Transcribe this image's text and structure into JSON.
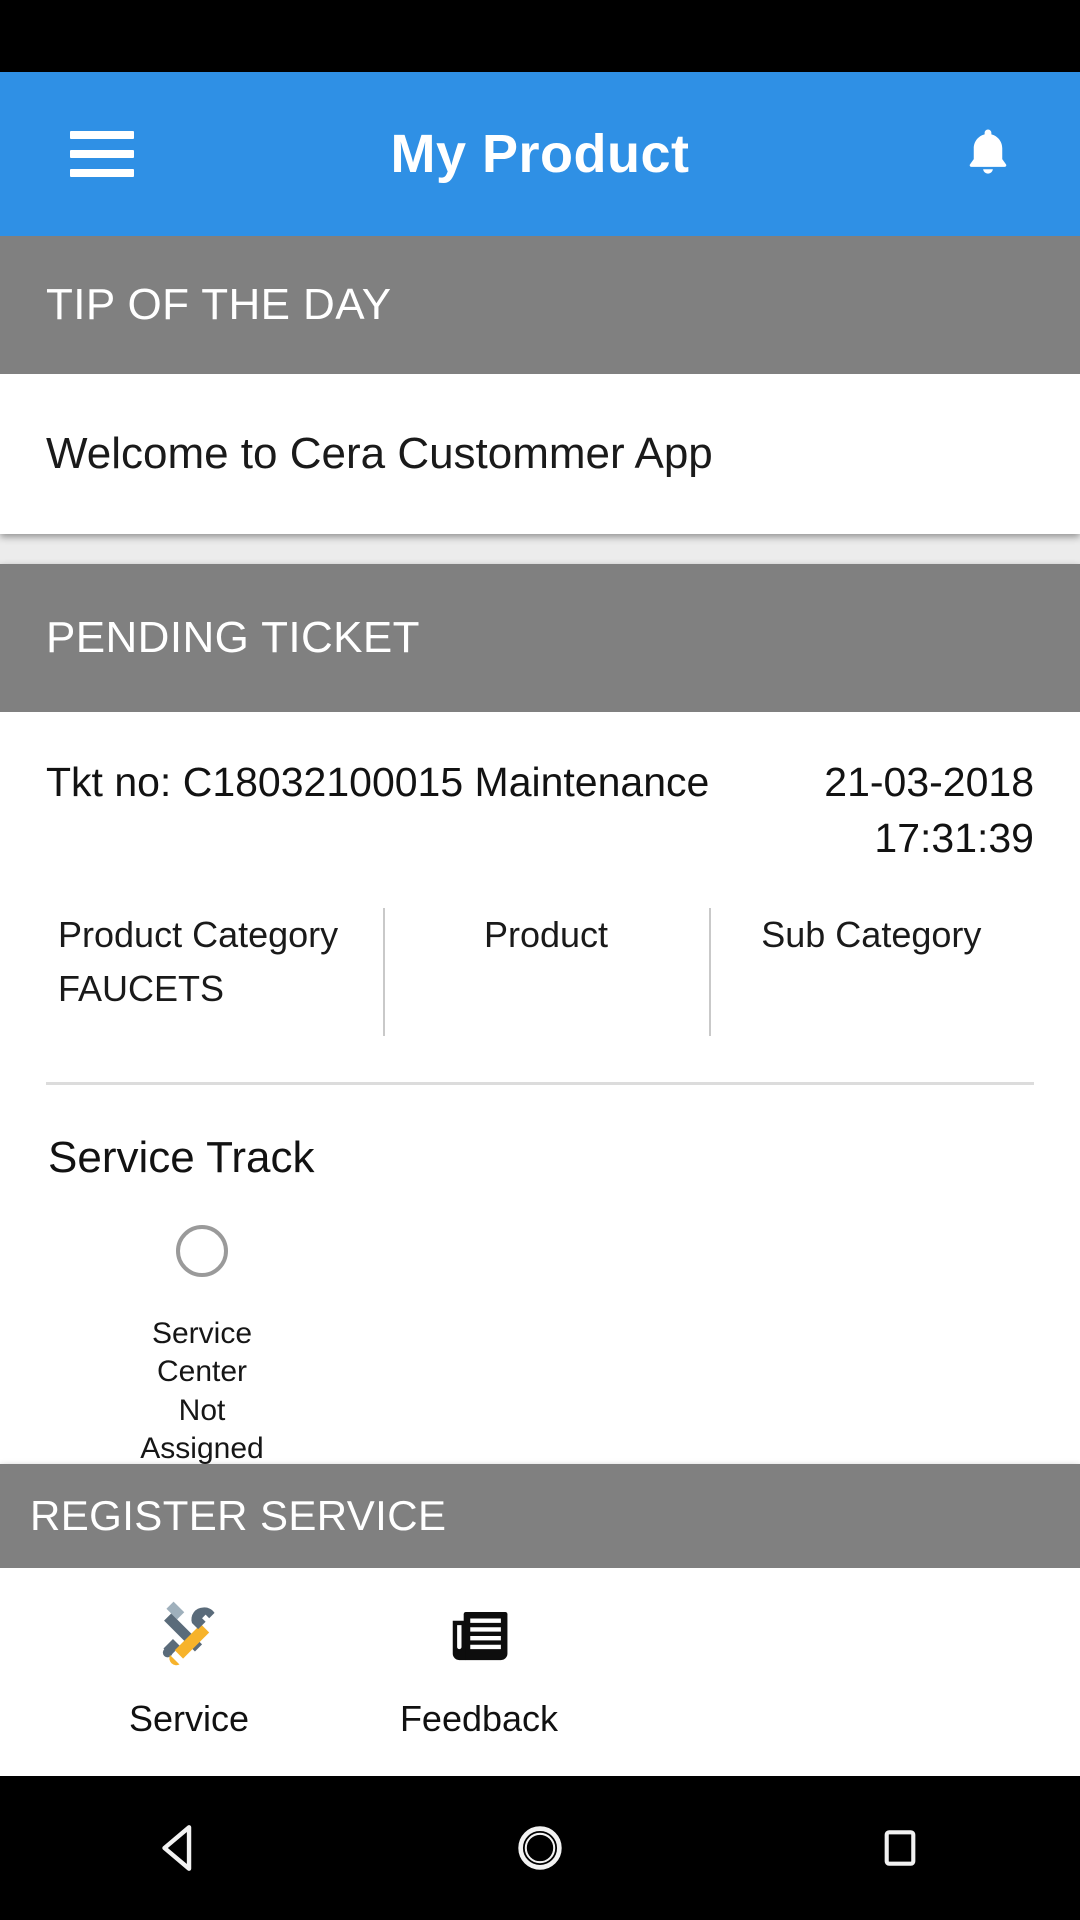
{
  "status_bar": {
    "present": true
  },
  "app_bar": {
    "menu_icon": "hamburger-menu-icon",
    "title": "My Product",
    "notification_icon": "bell-icon"
  },
  "tip_card": {
    "header": "TIP OF THE DAY",
    "message": "Welcome to Cera Custommer App"
  },
  "pending_ticket_card": {
    "header": "PENDING TICKET",
    "ticket_line": "Tkt no: C18032100015 Maintenance",
    "date": "21-03-2018",
    "time": "17:31:39",
    "meta": [
      {
        "label": "Product Category",
        "value": "FAUCETS"
      },
      {
        "label": "Product",
        "value": ""
      },
      {
        "label": "Sub Category",
        "value": ""
      }
    ],
    "service_track": {
      "title": "Service Track",
      "node_icon": "empty-circle-icon",
      "node_label_line1": "Service Center",
      "node_label_line2": "Not Assigned"
    }
  },
  "register_service_card": {
    "header": "REGISTER SERVICE",
    "actions": [
      {
        "icon": "tools-wrench-screwdriver-icon",
        "label": "Service"
      },
      {
        "icon": "newspaper-document-icon",
        "label": "Feedback"
      }
    ]
  },
  "nav_bar": {
    "back_icon": "back-triangle-icon",
    "home_icon": "home-circle-icon",
    "recents_icon": "recents-square-icon"
  },
  "colors": {
    "accent_blue": "#2F90E5",
    "section_gray": "#808080",
    "page_background": "#ECECEC",
    "card_white": "#FFFFFF",
    "system_black": "#000000",
    "divider": "#DCDCDC",
    "tool_orange": "#F7B32B",
    "tool_slate": "#5A6B7A"
  }
}
